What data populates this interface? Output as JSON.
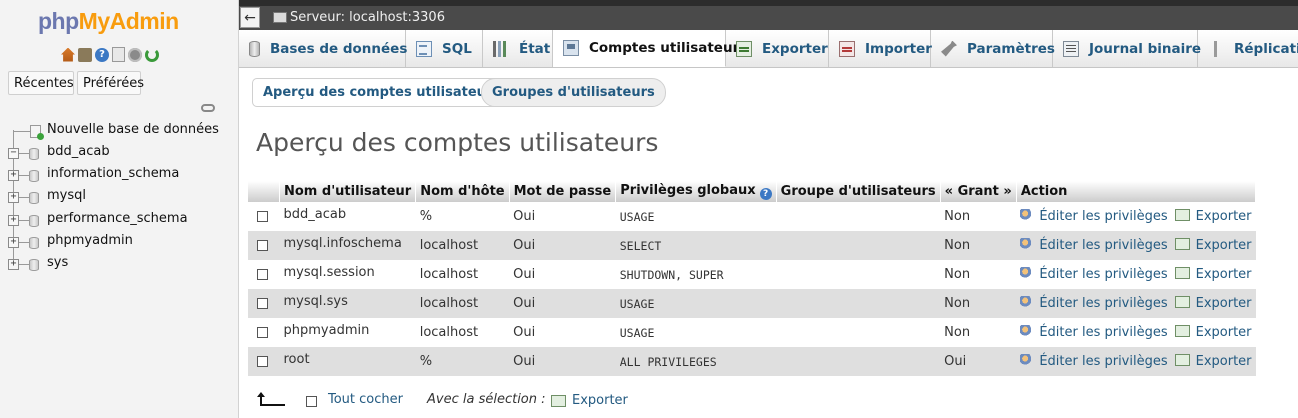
{
  "logo": {
    "php": "php",
    "myadmin": "MyAdmin"
  },
  "nav_icons": [
    "home-icon",
    "database-icon",
    "help-icon",
    "docs-icon",
    "settings-icon",
    "reload-icon"
  ],
  "left": {
    "recentes": "Récentes",
    "preferees": "Préférées",
    "new_db": "Nouvelle base de données",
    "databases": [
      "bdd_acab",
      "information_schema",
      "mysql",
      "performance_schema",
      "phpmyadmin",
      "sys"
    ]
  },
  "topbar": {
    "server": "Serveur: localhost:3306"
  },
  "tabs": [
    {
      "label": "Bases de données",
      "icon": "database-icon"
    },
    {
      "label": "SQL",
      "icon": "sql-icon"
    },
    {
      "label": "État",
      "icon": "status-icon"
    },
    {
      "label": "Comptes utilisateurs",
      "icon": "users-icon"
    },
    {
      "label": "Exporter",
      "icon": "export-icon"
    },
    {
      "label": "Importer",
      "icon": "import-icon"
    },
    {
      "label": "Paramètres",
      "icon": "wrench-icon"
    },
    {
      "label": "Journal binaire",
      "icon": "log-icon"
    },
    {
      "label": "Réplication",
      "icon": "replication-icon"
    }
  ],
  "active_tab": "Comptes utilisateurs",
  "subtabs": {
    "apercu": "Aperçu des comptes utilisateurs",
    "groupes": "Groupes d'utilisateurs"
  },
  "page_title": "Aperçu des comptes utilisateurs",
  "table": {
    "headers": [
      "Nom d'utilisateur",
      "Nom d'hôte",
      "Mot de passe",
      "Privilèges globaux",
      "Groupe d'utilisateurs",
      "« Grant »",
      "Action"
    ],
    "rows": [
      {
        "user": "bdd_acab",
        "host": "%",
        "password": "Oui",
        "privileges": "USAGE",
        "group": "",
        "grant": "Non"
      },
      {
        "user": "mysql.infoschema",
        "host": "localhost",
        "password": "Oui",
        "privileges": "SELECT",
        "group": "",
        "grant": "Non"
      },
      {
        "user": "mysql.session",
        "host": "localhost",
        "password": "Oui",
        "privileges": "SHUTDOWN, SUPER",
        "group": "",
        "grant": "Non"
      },
      {
        "user": "mysql.sys",
        "host": "localhost",
        "password": "Oui",
        "privileges": "USAGE",
        "group": "",
        "grant": "Non"
      },
      {
        "user": "phpmyadmin",
        "host": "localhost",
        "password": "Oui",
        "privileges": "USAGE",
        "group": "",
        "grant": "Non"
      },
      {
        "user": "root",
        "host": "%",
        "password": "Oui",
        "privileges": "ALL PRIVILEGES",
        "group": "",
        "grant": "Oui"
      }
    ],
    "edit_label": "Éditer les privilèges",
    "export_label": "Exporter"
  },
  "footer": {
    "check_all": "Tout cocher",
    "with_selection": "Avec la sélection :",
    "export": "Exporter"
  }
}
